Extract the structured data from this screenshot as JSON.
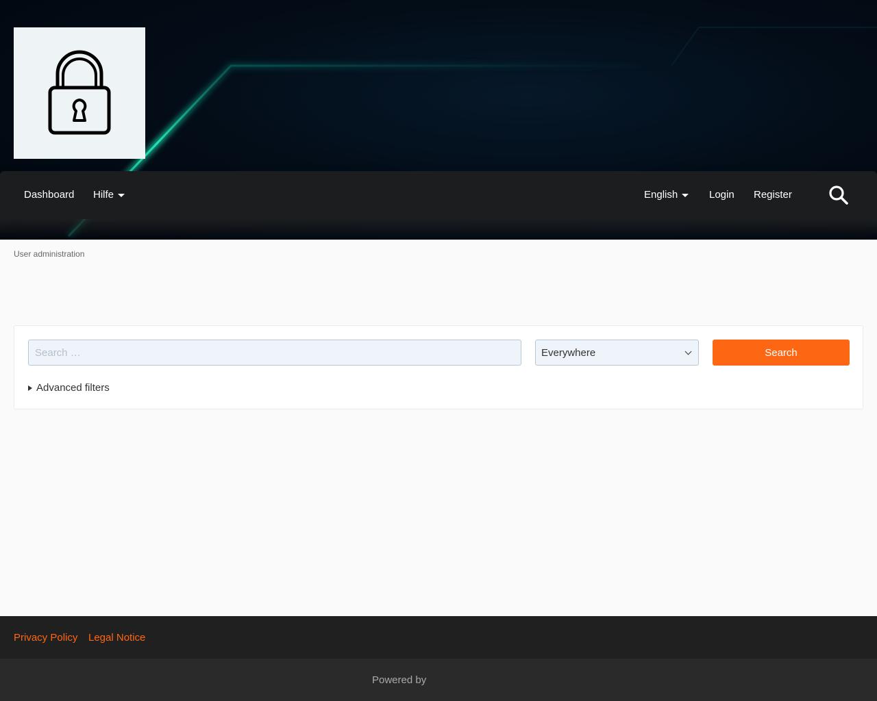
{
  "header": {
    "logo_icon": "padlock-icon"
  },
  "nav": {
    "items": [
      {
        "label": "Dashboard"
      },
      {
        "label": "Hilfe"
      }
    ],
    "language_label": "English",
    "login_label": "Login",
    "register_label": "Register",
    "search_icon": "search-icon"
  },
  "breadcrumb": {
    "label": "User administration"
  },
  "search": {
    "placeholder": "Search …",
    "value": "",
    "scope_selected": "Everywhere",
    "button_label": "Search",
    "advanced_label": "Advanced filters"
  },
  "footer": {
    "privacy_label": "Privacy Policy",
    "legal_label": "Legal Notice",
    "powered_label": "Powered by"
  },
  "colors": {
    "accent": "#fd6713",
    "nav_bg": "#1c1d1f",
    "header_bg": "#030d18",
    "glow": "#1ee3b4"
  }
}
